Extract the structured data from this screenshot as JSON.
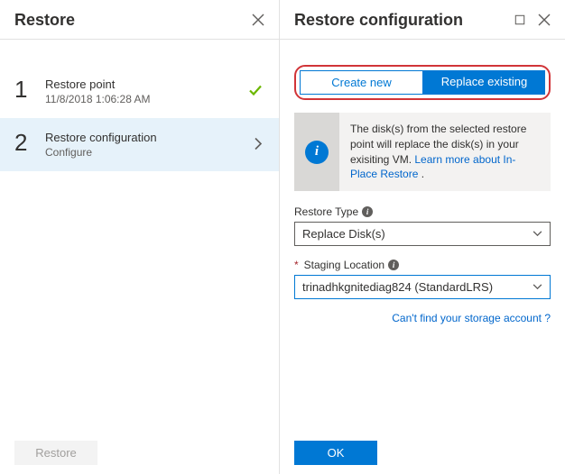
{
  "left": {
    "title": "Restore",
    "step1_title": "Restore point",
    "step1_sub": "11/8/2018 1:06:28 AM",
    "step2_title": "Restore configuration",
    "step2_sub": "Configure",
    "footer_btn": "Restore"
  },
  "right": {
    "title": "Restore configuration",
    "tab_create": "Create new",
    "tab_replace": "Replace existing",
    "info_text_a": "The disk(s) from the selected restore point will replace the disk(s) in your exisiting VM. ",
    "info_link_a": "Learn more about In-Place Restore",
    "info_dot": " .",
    "restore_type_label": "Restore Type",
    "restore_type_value": "Replace Disk(s)",
    "staging_label": "Staging Location",
    "staging_value": "trinadhkgnitediag824 (StandardLRS)",
    "help_link": "Can't find your storage account ?",
    "ok_btn": "OK"
  }
}
